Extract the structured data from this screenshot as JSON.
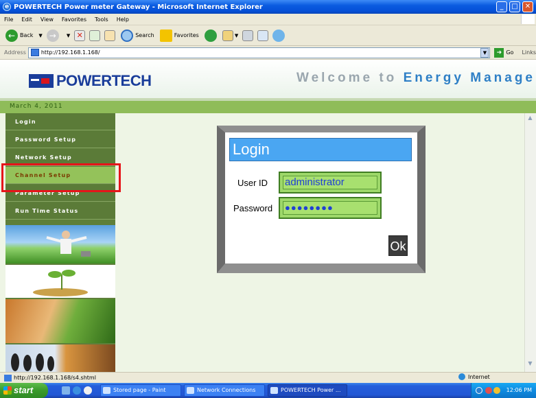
{
  "window": {
    "title": "POWERTECH Power meter Gateway - Microsoft Internet Explorer"
  },
  "menu": {
    "items": [
      "File",
      "Edit",
      "View",
      "Favorites",
      "Tools",
      "Help"
    ]
  },
  "toolbar": {
    "back": "Back",
    "search": "Search",
    "favorites": "Favorites"
  },
  "address": {
    "label": "Address",
    "url": "http://192.168.1.168/",
    "go": "Go",
    "links": "Links"
  },
  "page": {
    "logo": "POWERTECH",
    "welcome_prefix": "Welcome to ",
    "welcome_highlight": "Energy Manage",
    "date": "March 4, 2011",
    "nav": [
      {
        "label": "Login"
      },
      {
        "label": "Password Setup"
      },
      {
        "label": "Network Setup"
      },
      {
        "label": "Channel Setup"
      },
      {
        "label": "Parameter Setup"
      },
      {
        "label": "Run Time Status"
      }
    ],
    "login": {
      "title": "Login",
      "user_label": "User ID",
      "user_value": "administrator",
      "password_label": "Password",
      "password_value": "●●●●●●●●",
      "ok": "Ok"
    }
  },
  "status": {
    "url": "http://192.168.1.168/s4.shtml",
    "zone": "Internet"
  },
  "taskbar": {
    "start": "start",
    "tasks": [
      "Stored page - Paint",
      "Network Connections",
      "POWERTECH Power ..."
    ],
    "clock": "12:06 PM"
  }
}
